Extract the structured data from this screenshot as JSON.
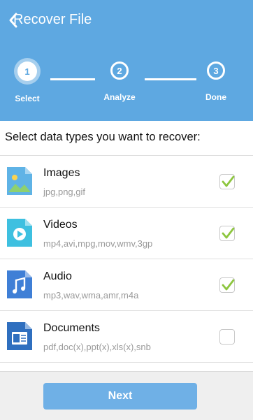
{
  "header": {
    "title": "Recover File",
    "bg_color": "#5ea8e1"
  },
  "steps": [
    {
      "number": "1",
      "label": "Select",
      "state": "active"
    },
    {
      "number": "2",
      "label": "Analyze",
      "state": "inactive"
    },
    {
      "number": "3",
      "label": "Done",
      "state": "inactive"
    }
  ],
  "prompt": "Select data types you want to recover:",
  "items": [
    {
      "title": "Images",
      "subtitle": "jpg,png,gif",
      "checked": true,
      "icon": "image-file-icon"
    },
    {
      "title": "Videos",
      "subtitle": "mp4,avi,mpg,mov,wmv,3gp",
      "checked": true,
      "icon": "video-file-icon"
    },
    {
      "title": "Audio",
      "subtitle": "mp3,wav,wma,amr,m4a",
      "checked": true,
      "icon": "audio-file-icon"
    },
    {
      "title": "Documents",
      "subtitle": "pdf,doc(x),ppt(x),xls(x),snb",
      "checked": false,
      "icon": "document-file-icon"
    }
  ],
  "footer": {
    "next_label": "Next"
  },
  "colors": {
    "check_green": "#8dc63f",
    "button_blue": "#6fb0e6"
  }
}
